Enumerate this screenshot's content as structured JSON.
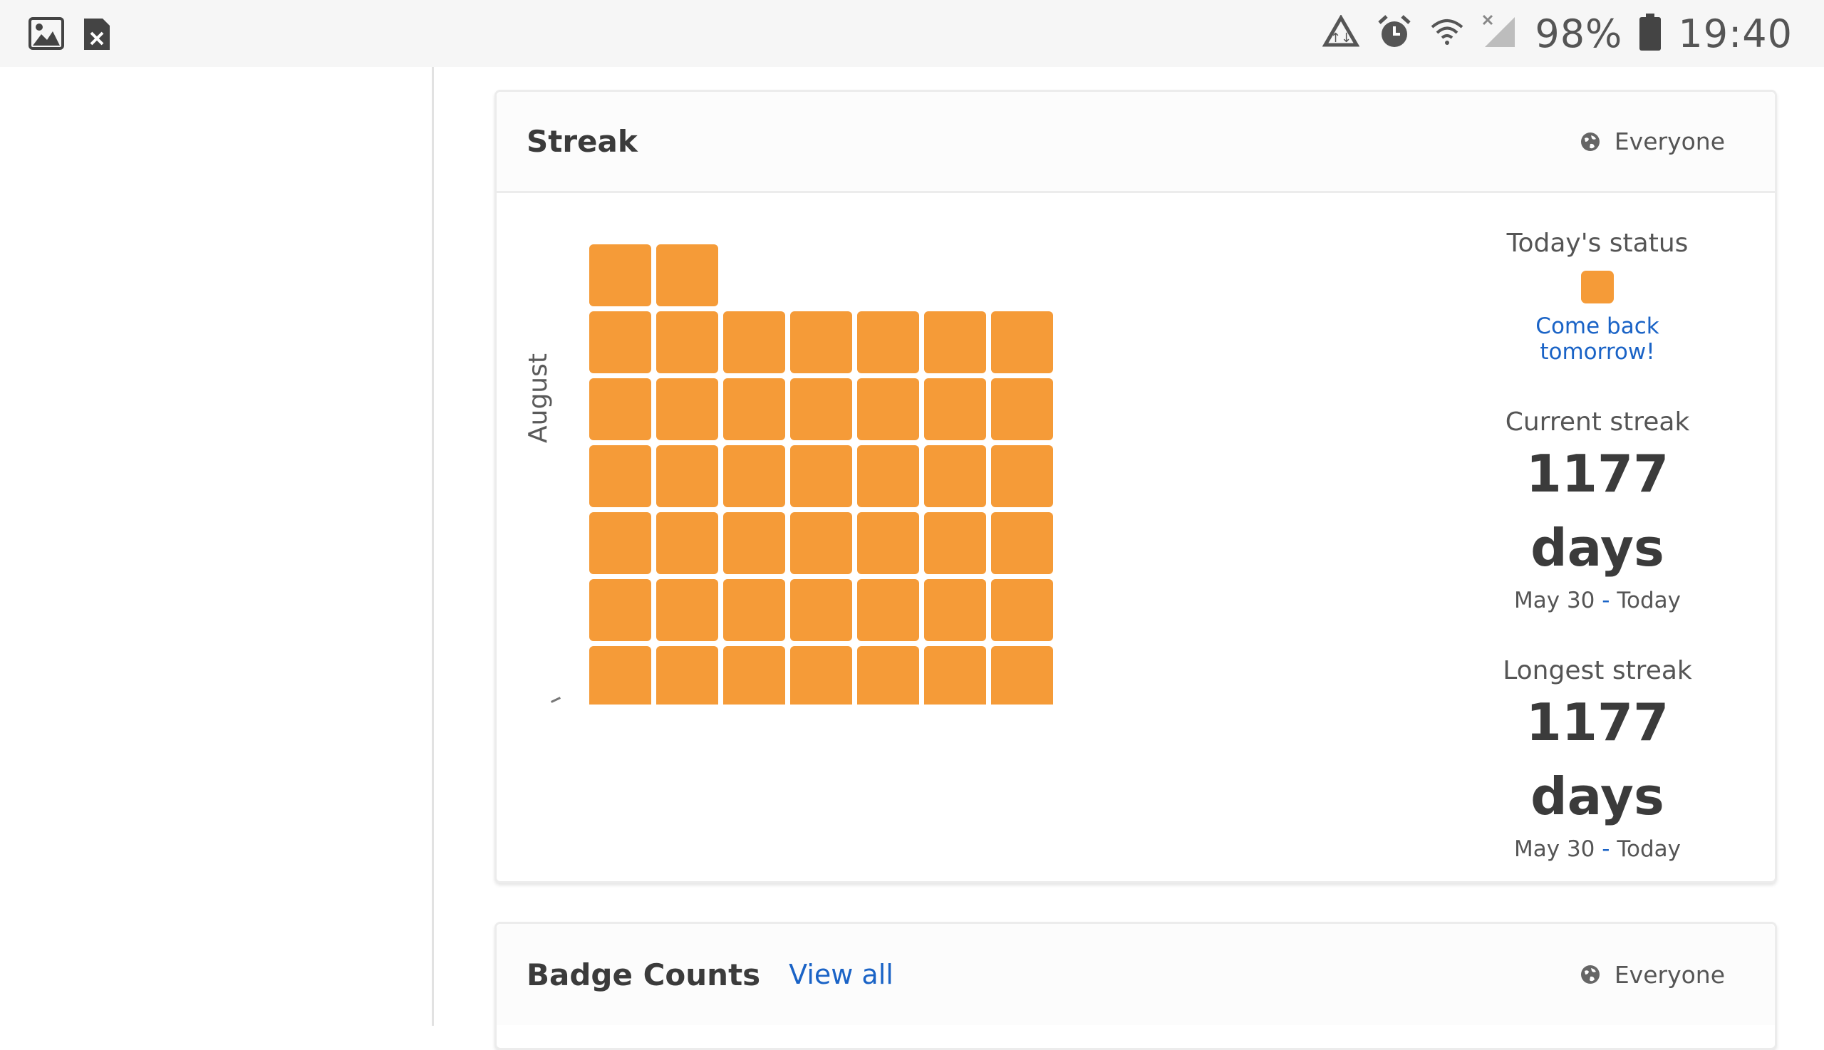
{
  "status_bar": {
    "battery": "98%",
    "time": "19:40",
    "left_icons": [
      "image-icon",
      "close-file-icon"
    ],
    "right_icons": [
      "recycle-icon",
      "alarm-icon",
      "wifi-icon",
      "signal-icon",
      "battery-icon"
    ]
  },
  "streak_card": {
    "title": "Streak",
    "visibility": "Everyone",
    "month_label": "August",
    "grid_rows": [
      2,
      7,
      7,
      7,
      7,
      7,
      7
    ],
    "cell_color": "#f59b38",
    "todays_status_label": "Today's status",
    "todays_status_message": "Come back tomorrow!",
    "current_streak_label": "Current streak",
    "current_streak_value": "1177",
    "current_streak_unit": "days",
    "current_streak_start": "May 30",
    "current_streak_end": "Today",
    "longest_streak_label": "Longest streak",
    "longest_streak_value": "1177",
    "longest_streak_unit": "days",
    "longest_streak_start": "May 30",
    "longest_streak_end": "Today"
  },
  "badge_card": {
    "title": "Badge Counts",
    "view_all": "View all",
    "visibility": "Everyone"
  },
  "colors": {
    "accent": "#f59b38",
    "link": "#1a63c6"
  }
}
